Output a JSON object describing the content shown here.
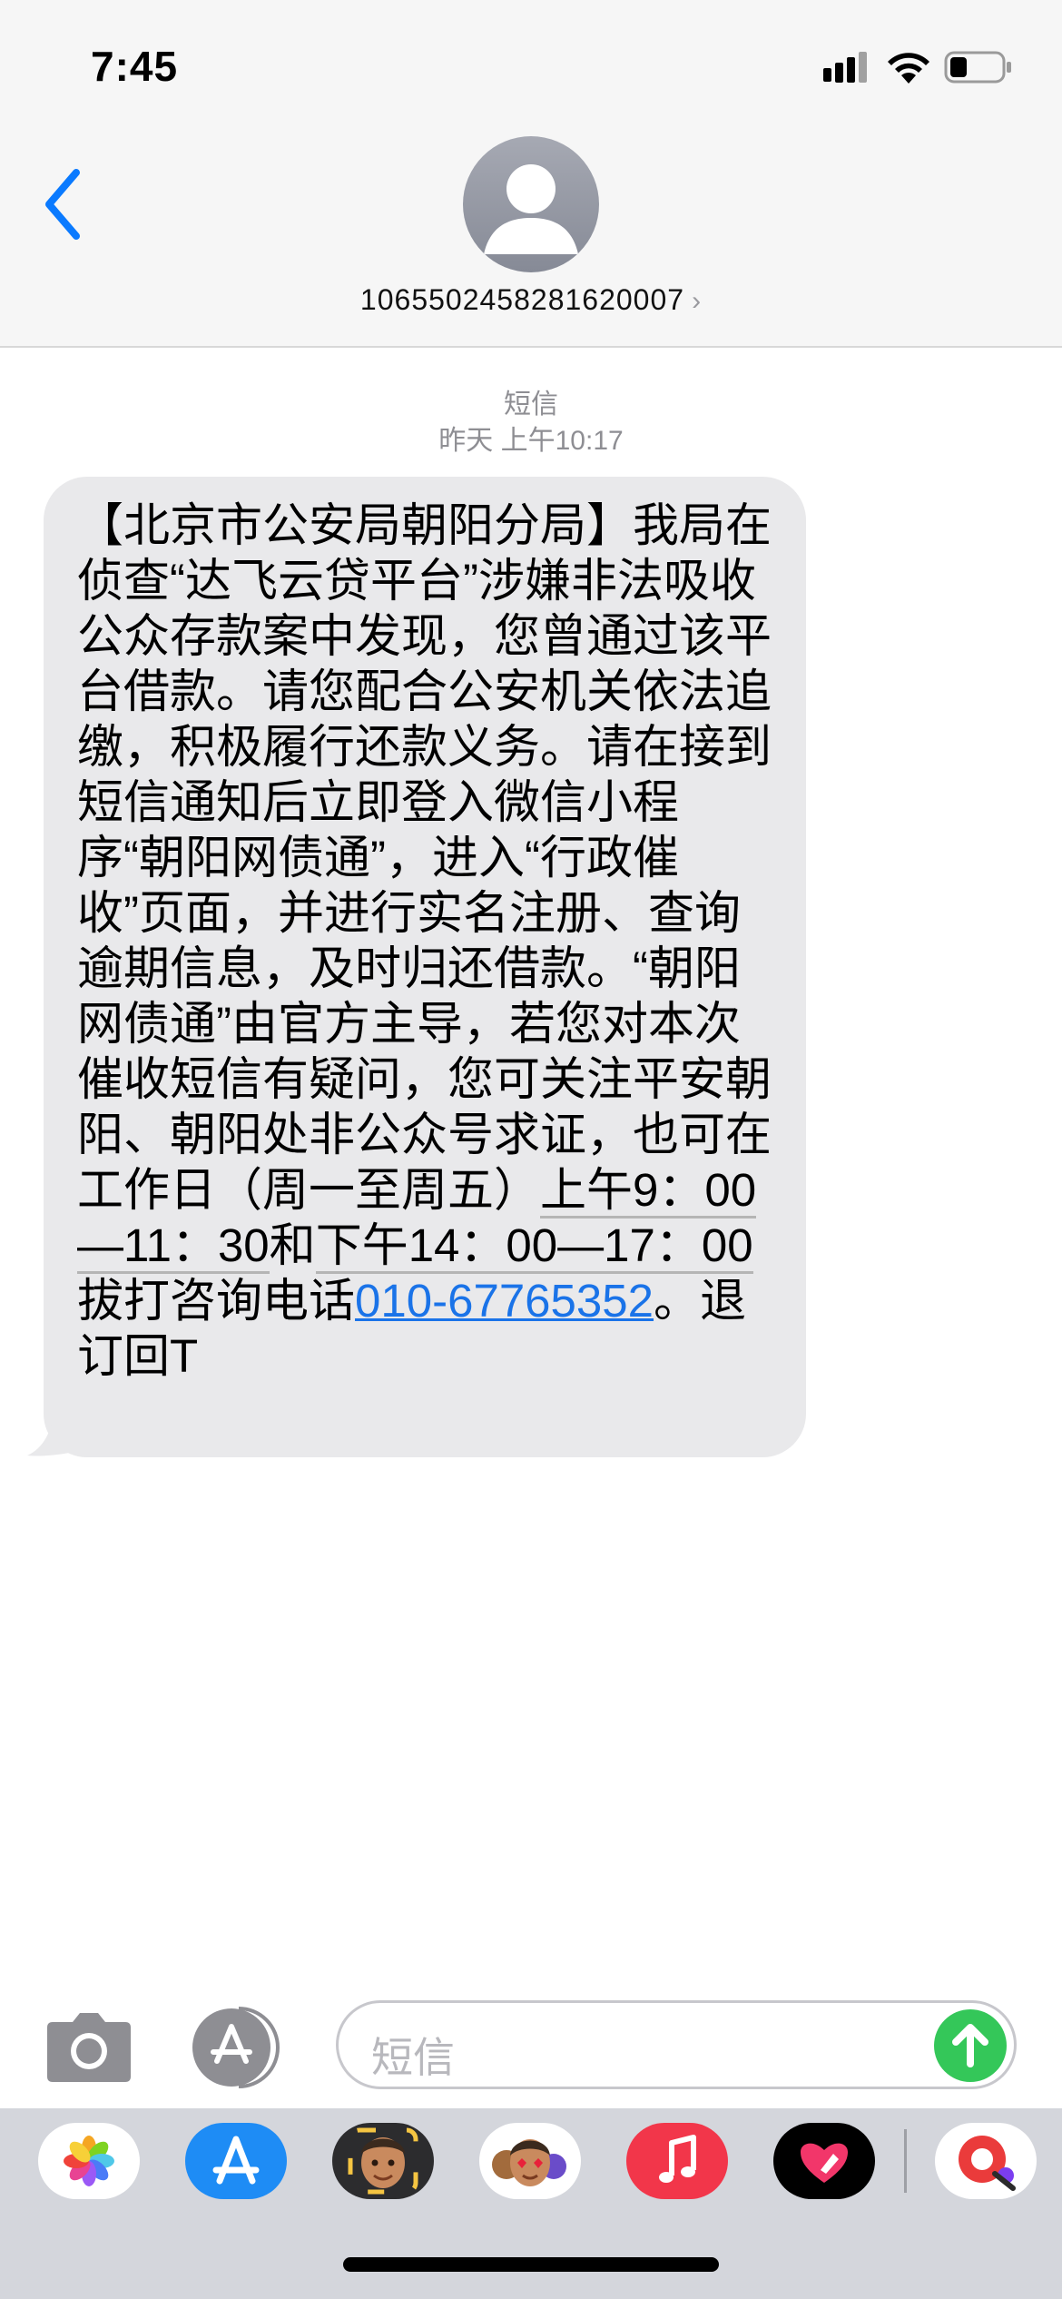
{
  "status_bar": {
    "time": "7:45",
    "icons": [
      "signal-icon",
      "wifi-icon",
      "battery-icon"
    ]
  },
  "header": {
    "contact_number": "1065502458281620007",
    "back_icon": "chevron-left-icon",
    "avatar_icon": "person-icon"
  },
  "conversation": {
    "service_label": "短信",
    "timestamp": "昨天 上午10:17",
    "message": {
      "part1": "【北京市公安局朝阳分局】我局在侦查“达飞云贷平台”涉嫌非法吸收公众存款案中发现，您曾通过该平台借款。请您配合公安机关依法追缴，积极履行还款义务。请在接到短信通知后立即登入微信小程序“朝阳网债通”，进入“行政催收”页面，并进行实名注册、查询逾期信息，及时归还借款。“朝阳网债通”由官方主导，若您对本次催收短信有疑问，您可关注平安朝阳、朝阳处非公众号求证，也可在工作日（周一至周五）",
      "time_range_1": "上午9：00—11：30",
      "and": "和",
      "time_range_2": "下午14：00—17：00",
      "part2": "拔打咨询电话",
      "phone": "010-67765352",
      "part3": "。退订回T"
    }
  },
  "input_bar": {
    "placeholder": "短信",
    "icons": [
      "camera-icon",
      "app-store-icon",
      "send-icon"
    ]
  },
  "app_drawer": {
    "apps": [
      "photos-icon",
      "app-store-icon",
      "memoji-icon",
      "animoji-icon",
      "music-icon",
      "digital-touch-icon",
      "search-images-icon"
    ]
  },
  "colors": {
    "accent": "#1a73e8",
    "bubble": "#e9e9eb",
    "send": "#34c759",
    "meta": "#8e8e93"
  }
}
